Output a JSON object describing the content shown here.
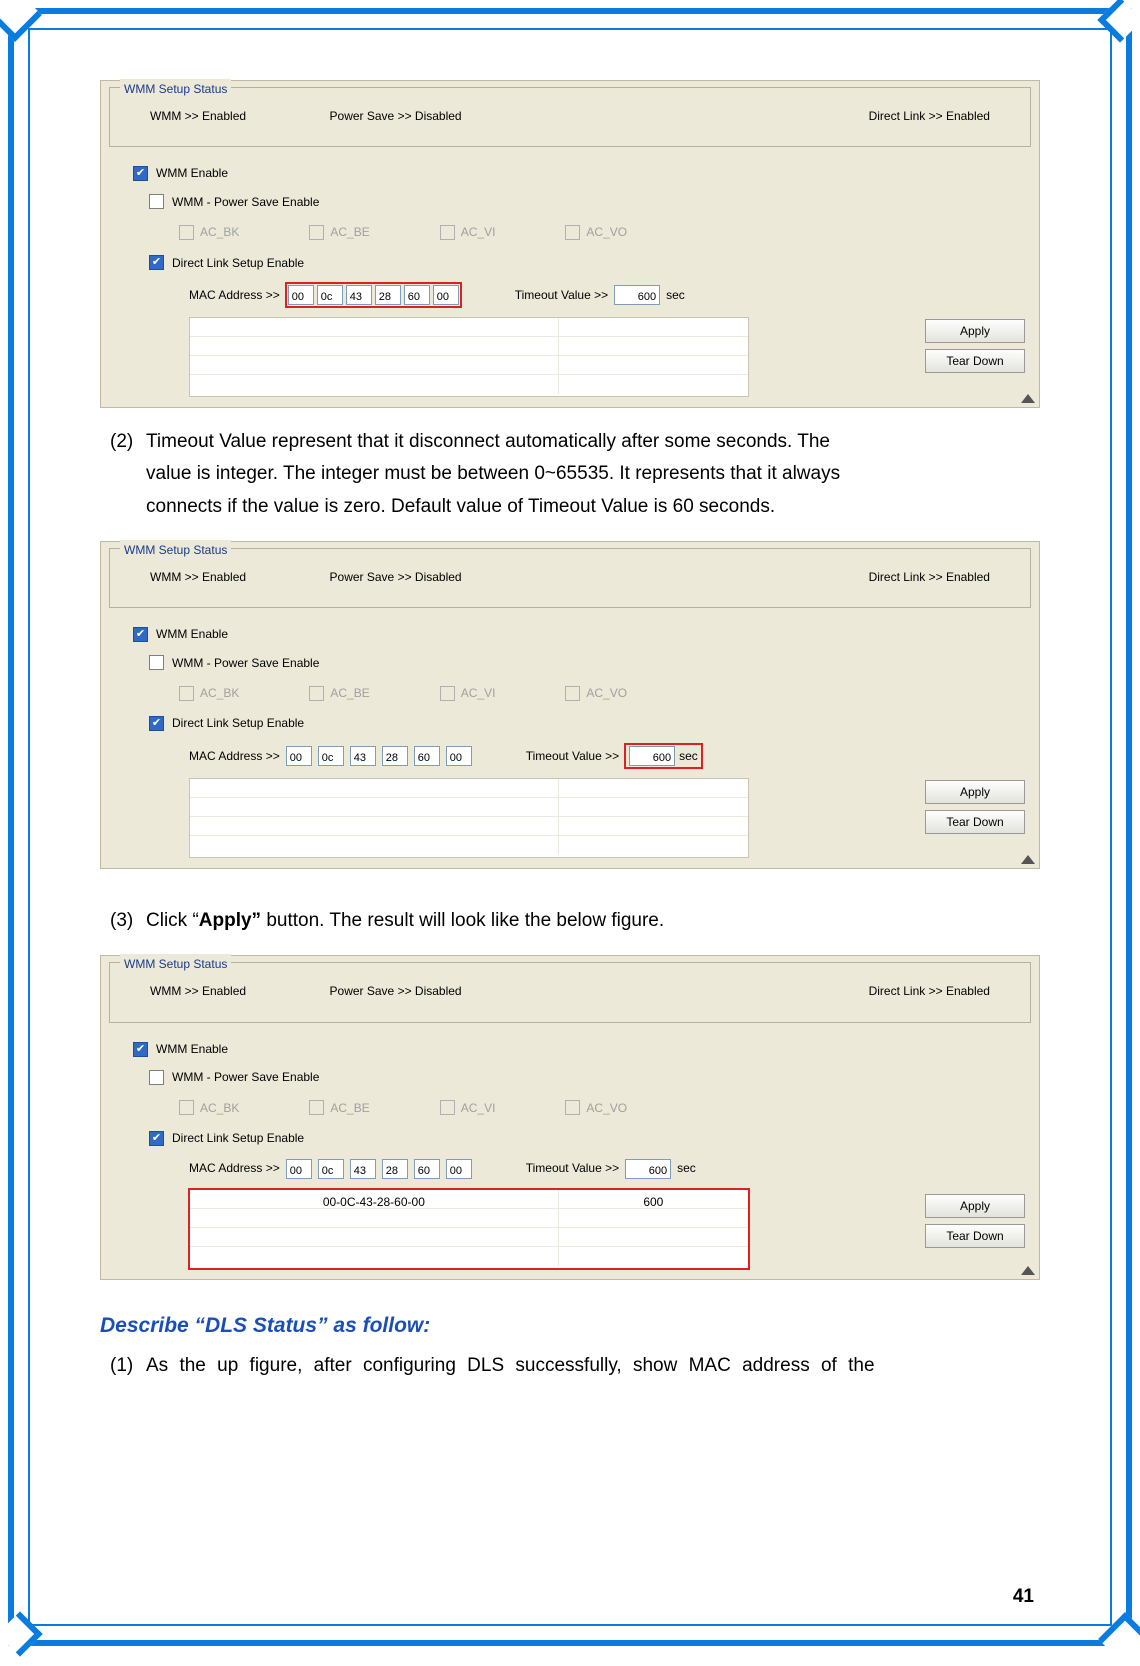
{
  "fieldset_legend": "WMM Setup Status",
  "status": {
    "wmm": "WMM >> Enabled",
    "power": "Power Save >> Disabled",
    "direct": "Direct Link >> Enabled"
  },
  "labels": {
    "wmm_enable": "WMM Enable",
    "ps_enable": "WMM - Power Save Enable",
    "ac_bk": "AC_BK",
    "ac_be": "AC_BE",
    "ac_vi": "AC_VI",
    "ac_vo": "AC_VO",
    "dls_enable": "Direct Link Setup Enable",
    "mac_addr": "MAC Address >>",
    "timeout": "Timeout Value >>",
    "sec": "sec"
  },
  "mac": [
    "00",
    "0c",
    "43",
    "28",
    "60",
    "00"
  ],
  "timeout_value": "600",
  "buttons": {
    "apply": "Apply",
    "tear": "Tear Down"
  },
  "table_result": {
    "mac": "00-0C-43-28-60-00",
    "timeout": "600"
  },
  "text": {
    "para2_num": "(2)",
    "para2_l1": "Timeout Value represent that it disconnect automatically after some seconds. The",
    "para2_l2": "value is integer. The integer must be between 0~65535. It represents that it always",
    "para2_l3": "connects if the value is zero. Default value of Timeout Value is 60 seconds.",
    "para3_num": "(3)",
    "para3_a": "Click “",
    "para3_bold": "Apply”",
    "para3_b": " button. The result will look like the below figure.",
    "sec_head": "Describe “DLS Status” as follow:",
    "para4_num": "(1)",
    "para4_a": "As the up figure, after configuring DLS successfully, show MAC address of the"
  },
  "page_number": "41"
}
